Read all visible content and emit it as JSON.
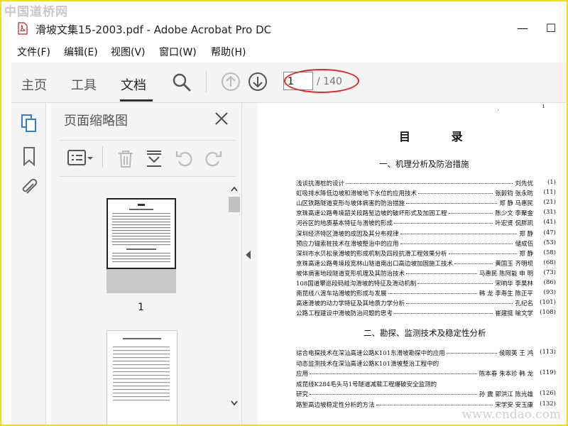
{
  "watermarks": {
    "top": "中国道桥网",
    "bottom": "www.cndao.com"
  },
  "window": {
    "title": "滑坡文集15-2003.pdf - Adobe Acrobat Pro DC",
    "minimize": "—",
    "maximize": "☐"
  },
  "menu": [
    "文件(F)",
    "编辑(E)",
    "视图(V)",
    "窗口(W)",
    "帮助(H)"
  ],
  "toolbar": {
    "tabs": [
      {
        "label": "主页"
      },
      {
        "label": "工具"
      },
      {
        "label": "文档",
        "active": true
      }
    ],
    "page_current": "1",
    "page_total": "/ 140"
  },
  "panel": {
    "title": "页面缩略图",
    "thumb_label": "1"
  },
  "colors": {
    "accent": "#2f7fd1",
    "annotation": "#e3241c",
    "border": "#f2dd1c"
  },
  "icons": [
    "search-icon",
    "prev-page-icon",
    "next-page-icon",
    "page-thumbnails-icon",
    "bookmark-icon",
    "attachment-icon",
    "close-icon",
    "options-menu-icon",
    "delete-icon",
    "extract-icon",
    "rotate-left-icon",
    "rotate-right-icon"
  ],
  "document": {
    "heading": "目 录",
    "section1": "一、机理分析及防治措施",
    "section2": "二、勘探、监测技术及稳定性分析",
    "entries1": [
      {
        "title": "浅谈抗滑桩的设计",
        "author": "刘先优",
        "page": "(1)"
      },
      {
        "title": "虹吸排水降低边坡和滑坡地下水位的应用技术",
        "author": "张毅钧  张永昉",
        "page": "(11)"
      },
      {
        "title": "山区铁路隧道变形与坡体病害的防治措施",
        "author": "郑  静  马惠民",
        "page": "(21)"
      },
      {
        "title": "京珠高速公路粤境韶关段路堑边坡的破坏形式及加固工程",
        "author": "陈少文  李聚金",
        "page": "(31)"
      },
      {
        "title": "河谷区的地质基本特征与滑坡的形成",
        "author": "叶宏贤  侃胖凯",
        "page": "(41)"
      },
      {
        "title": "深圳经济特区滑坡的成因及其分布规律",
        "author": "郑  静",
        "page": "(47)"
      },
      {
        "title": "预应力锚索桩技术在滑坡整治中的应用",
        "author": "储成伍",
        "page": "(53)"
      },
      {
        "title": "深圳市水贝松泉滑坡的形成机制及四段抗滑工程效果分析",
        "author": "郑  静",
        "page": "(58)"
      },
      {
        "title": "京珠高速公路粤境段宽林山隧道南出口高边坡加固施工技术",
        "author": "黄国玉  齐明坝",
        "page": "(68)"
      },
      {
        "title": "坡体病害地段隧道变形机理及其防治技术",
        "author": "马惠民  陈阿能  申  明",
        "page": "(73)"
      },
      {
        "title": "108国道攀巡段码畦沟滑坡的特征及滑动机制",
        "author": "宋响华  李昊林",
        "page": "(86)"
      },
      {
        "title": "南昆线八渡车站滑坡的形成与发展",
        "author": "韩  龙  李寿生  陈正平",
        "page": "(93)"
      },
      {
        "title": "高速滑坡的动力学特征及其地质力学分析",
        "author": "孔纪名",
        "page": "(101)"
      },
      {
        "title": "公路工程建设中滑坡防治问题的思考",
        "author": "崔建挺  喻文学",
        "page": "(108)"
      }
    ],
    "entries2": [
      {
        "title": "综合电探技术在深汕高速公路K101东滑坡勘探中的应用",
        "author": "侯殿英  王  鸿",
        "page": "(113)"
      },
      {
        "title": "动态监测技术在深汕高速公路K101滑坡整治工程中的",
        "author": "",
        "page": ""
      },
      {
        "title": "    应用",
        "author": "陈本春  朱本珍  韩  龙",
        "page": "(119)"
      },
      {
        "title": "成昆线K284毛头马1号隧道减载工程爆破安全监测的",
        "author": "",
        "page": ""
      },
      {
        "title": "    研究",
        "author": "孙  震  郭洪江  陈光雄",
        "page": "(126)"
      },
      {
        "title": "路堑高边坡稳定性分析的方法",
        "author": "宋学安  安玉康",
        "page": "(132)"
      }
    ]
  }
}
